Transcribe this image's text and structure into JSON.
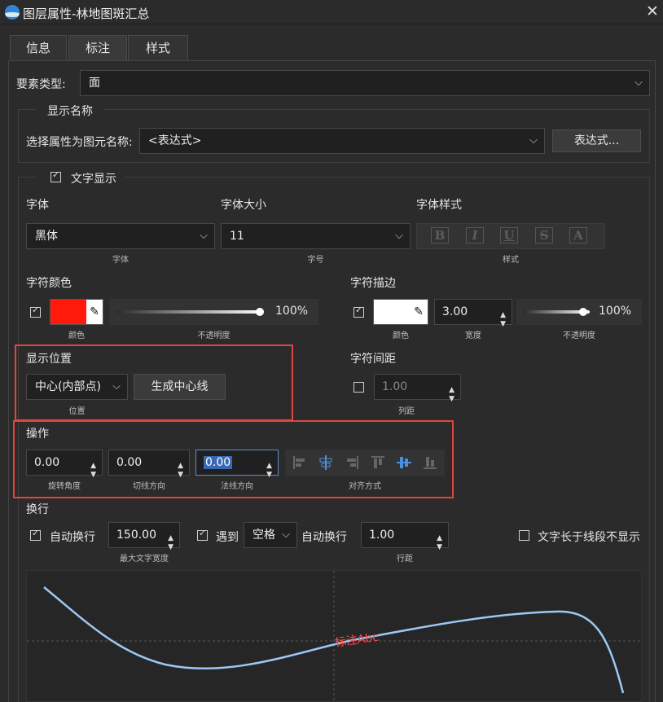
{
  "window": {
    "title": "图层属性-林地图斑汇总",
    "close_glyph": "✕"
  },
  "tabs": [
    {
      "label": "信息",
      "active": false
    },
    {
      "label": "标注",
      "active": true
    },
    {
      "label": "样式",
      "active": false
    }
  ],
  "feature_type": {
    "label": "要素类型:",
    "value": "面"
  },
  "display_name": {
    "group_title": "显示名称",
    "select_label": "选择属性为图元名称:",
    "select_value": "<表达式>",
    "expr_button": "表达式..."
  },
  "text_display": {
    "group_title": "文字显示",
    "enabled": true,
    "font": {
      "title": "字体",
      "value": "黑体",
      "caption": "字体"
    },
    "font_size": {
      "title": "字体大小",
      "value": "11",
      "caption": "字号"
    },
    "font_style": {
      "title": "字体样式",
      "caption": "样式",
      "icons": [
        "B",
        "I",
        "U",
        "S",
        "A"
      ]
    },
    "char_color": {
      "title": "字符颜色",
      "enabled": true,
      "color": "#ff1a0a",
      "color_caption": "颜色",
      "opacity": "100%",
      "opacity_value": 1.0,
      "opacity_caption": "不透明度"
    },
    "char_stroke": {
      "title": "字符描边",
      "enabled": true,
      "color": "#ffffff",
      "color_caption": "颜色",
      "width": "3.00",
      "width_caption": "宽度",
      "opacity": "100%",
      "opacity_value": 1.0,
      "opacity_caption": "不透明度"
    },
    "position": {
      "title": "显示位置",
      "value": "中心(内部点)",
      "caption": "位置",
      "gen_button": "生成中心线"
    },
    "spacing": {
      "title": "字符间距",
      "enabled": false,
      "value": "1.00",
      "caption": "列距"
    },
    "operation": {
      "title": "操作",
      "rotation": {
        "value": "0.00",
        "caption": "旋转角度"
      },
      "tangent": {
        "value": "0.00",
        "caption": "切线方向"
      },
      "normal": {
        "value": "0.00",
        "caption": "法线方向"
      },
      "align_caption": "对齐方式",
      "align_icons": [
        "align-left-icon",
        "align-hcenter-icon",
        "align-right-icon",
        "align-top-icon",
        "align-vcenter-icon",
        "align-bottom-icon"
      ]
    },
    "wrap": {
      "title": "换行",
      "auto_wrap": {
        "enabled": true,
        "label": "自动换行",
        "value": "150.00",
        "caption": "最大文字宽度"
      },
      "wrap_on": {
        "enabled": true,
        "label": "遇到",
        "select": "空格",
        "suffix": "自动换行"
      },
      "line_spacing": {
        "value": "1.00",
        "caption": "行距"
      },
      "hide_long": {
        "enabled": false,
        "label": "文字长于线段不显示"
      }
    }
  },
  "preview": {
    "label_text": "标注Abc",
    "curve_color": "#9cc8f5",
    "label_color": "#ff4a4a"
  },
  "colors": {
    "highlight_box": "#e0463f",
    "background": "#2b2b2b"
  }
}
